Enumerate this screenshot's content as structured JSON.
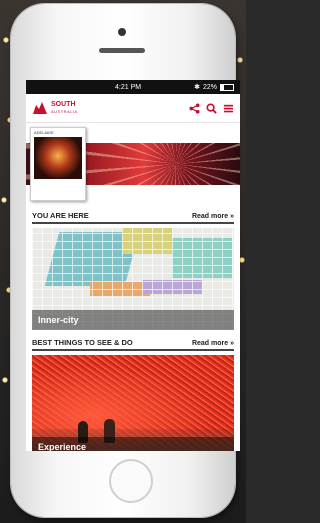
{
  "status_bar": {
    "time": "4:21 PM",
    "battery": "22%",
    "battery_level": 0.22
  },
  "brand": {
    "name": "SOUTH",
    "subname": "AUSTRALIA",
    "color": "#c8102e"
  },
  "header_icons": [
    "share-icon",
    "search-icon",
    "menu-icon"
  ],
  "promo": {
    "magazine_header": "ADELAIDE"
  },
  "sections": [
    {
      "title": "YOU ARE HERE",
      "read_more": "Read more »",
      "card_label": "Inner-city"
    },
    {
      "title": "BEST THINGS TO SEE & DO",
      "read_more": "Read more »",
      "card_label": "Experience"
    }
  ]
}
